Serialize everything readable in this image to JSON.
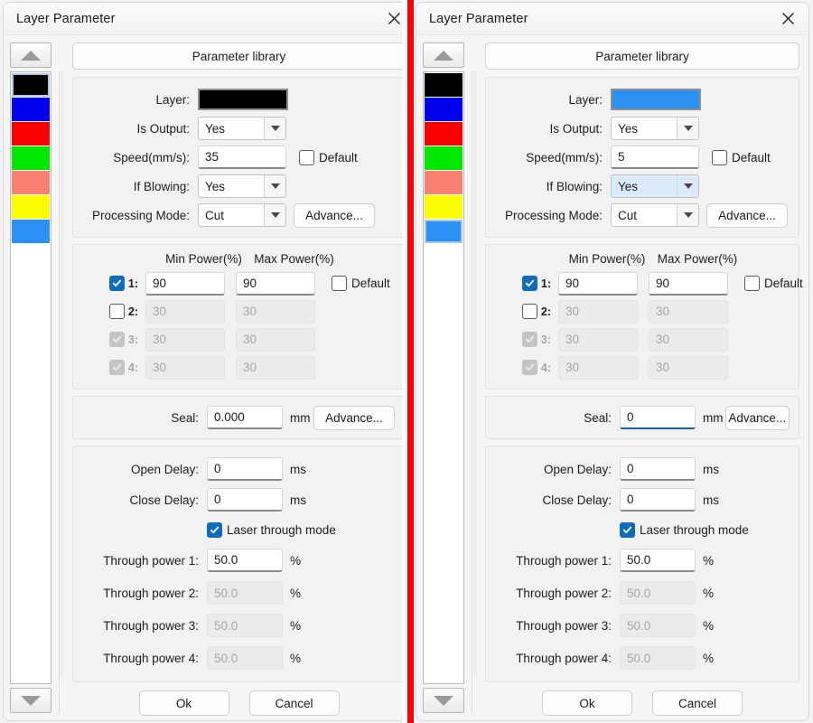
{
  "accent": "#0f6cbd",
  "separator_color": "#fb0007",
  "swatch_colors": [
    "#000000",
    "#0000ee",
    "#fb0000",
    "#00e800",
    "#f98071",
    "#fdfb00",
    "#2a90f2"
  ],
  "icons": {
    "close": "close-icon",
    "scroll_up": "triangle-up-icon",
    "scroll_down": "triangle-down-icon",
    "dropdown": "chevron-down-icon",
    "check": "checkmark-icon"
  },
  "common": {
    "title": "Layer Parameter",
    "parameter_library": "Parameter library",
    "labels": {
      "layer": "Layer:",
      "is_output": "Is Output:",
      "speed": "Speed(mm/s):",
      "if_blowing": "If Blowing:",
      "processing_mode": "Processing Mode:",
      "min_power": "Min Power(%)",
      "max_power": "Max Power(%)",
      "seal": "Seal:",
      "open_delay": "Open Delay:",
      "close_delay": "Close Delay:",
      "laser_through_mode": "Laser through mode",
      "through_power_1": "Through power 1:",
      "through_power_2": "Through power 2:",
      "through_power_3": "Through power 3:",
      "through_power_4": "Through power 4:",
      "default": "Default",
      "advance": "Advance...",
      "row_1": "1:",
      "row_2": "2:",
      "row_3": "3:",
      "row_4": "4:"
    },
    "units": {
      "mm": "mm",
      "ms": "ms",
      "percent": "%"
    },
    "buttons": {
      "ok": "Ok",
      "cancel": "Cancel"
    }
  },
  "left_dialog": {
    "title": "Layer Parameter",
    "layer_color": "#000000",
    "selected_swatch_index": 0,
    "is_output": "Yes",
    "speed": "35",
    "speed_default_checked": false,
    "if_blowing": "Yes",
    "if_blowing_highlight": false,
    "processing_mode": "Cut",
    "power_rows": [
      {
        "index": "1:",
        "enabled": true,
        "checkbox": "checked",
        "min": "90",
        "max": "90"
      },
      {
        "index": "2:",
        "enabled": true,
        "checkbox": "unchecked",
        "min": "30",
        "max": "30"
      },
      {
        "index": "3:",
        "enabled": false,
        "checkbox": "disabled-checked",
        "min": "30",
        "max": "30"
      },
      {
        "index": "4:",
        "enabled": false,
        "checkbox": "disabled-checked",
        "min": "30",
        "max": "30"
      }
    ],
    "power_default_checked": false,
    "seal": "0.000",
    "seal_focused": false,
    "open_delay": "0",
    "close_delay": "0",
    "laser_through_checked": true,
    "through_powers": [
      {
        "value": "50.0",
        "enabled": true
      },
      {
        "value": "50.0",
        "enabled": false
      },
      {
        "value": "50.0",
        "enabled": false
      },
      {
        "value": "50.0",
        "enabled": false
      }
    ]
  },
  "right_dialog": {
    "title": "Layer Parameter",
    "layer_color": "#2a90f2",
    "selected_swatch_index": 6,
    "is_output": "Yes",
    "speed": "5",
    "speed_default_checked": false,
    "if_blowing": "Yes",
    "if_blowing_highlight": true,
    "processing_mode": "Cut",
    "power_rows": [
      {
        "index": "1:",
        "enabled": true,
        "checkbox": "checked",
        "min": "90",
        "max": "90"
      },
      {
        "index": "2:",
        "enabled": true,
        "checkbox": "unchecked",
        "min": "30",
        "max": "30"
      },
      {
        "index": "3:",
        "enabled": false,
        "checkbox": "disabled-checked",
        "min": "30",
        "max": "30"
      },
      {
        "index": "4:",
        "enabled": false,
        "checkbox": "disabled-checked",
        "min": "30",
        "max": "30"
      }
    ],
    "power_default_checked": false,
    "seal": "0",
    "seal_focused": true,
    "open_delay": "0",
    "close_delay": "0",
    "laser_through_checked": true,
    "through_powers": [
      {
        "value": "50.0",
        "enabled": true
      },
      {
        "value": "50.0",
        "enabled": false
      },
      {
        "value": "50.0",
        "enabled": false
      },
      {
        "value": "50.0",
        "enabled": false
      }
    ]
  }
}
